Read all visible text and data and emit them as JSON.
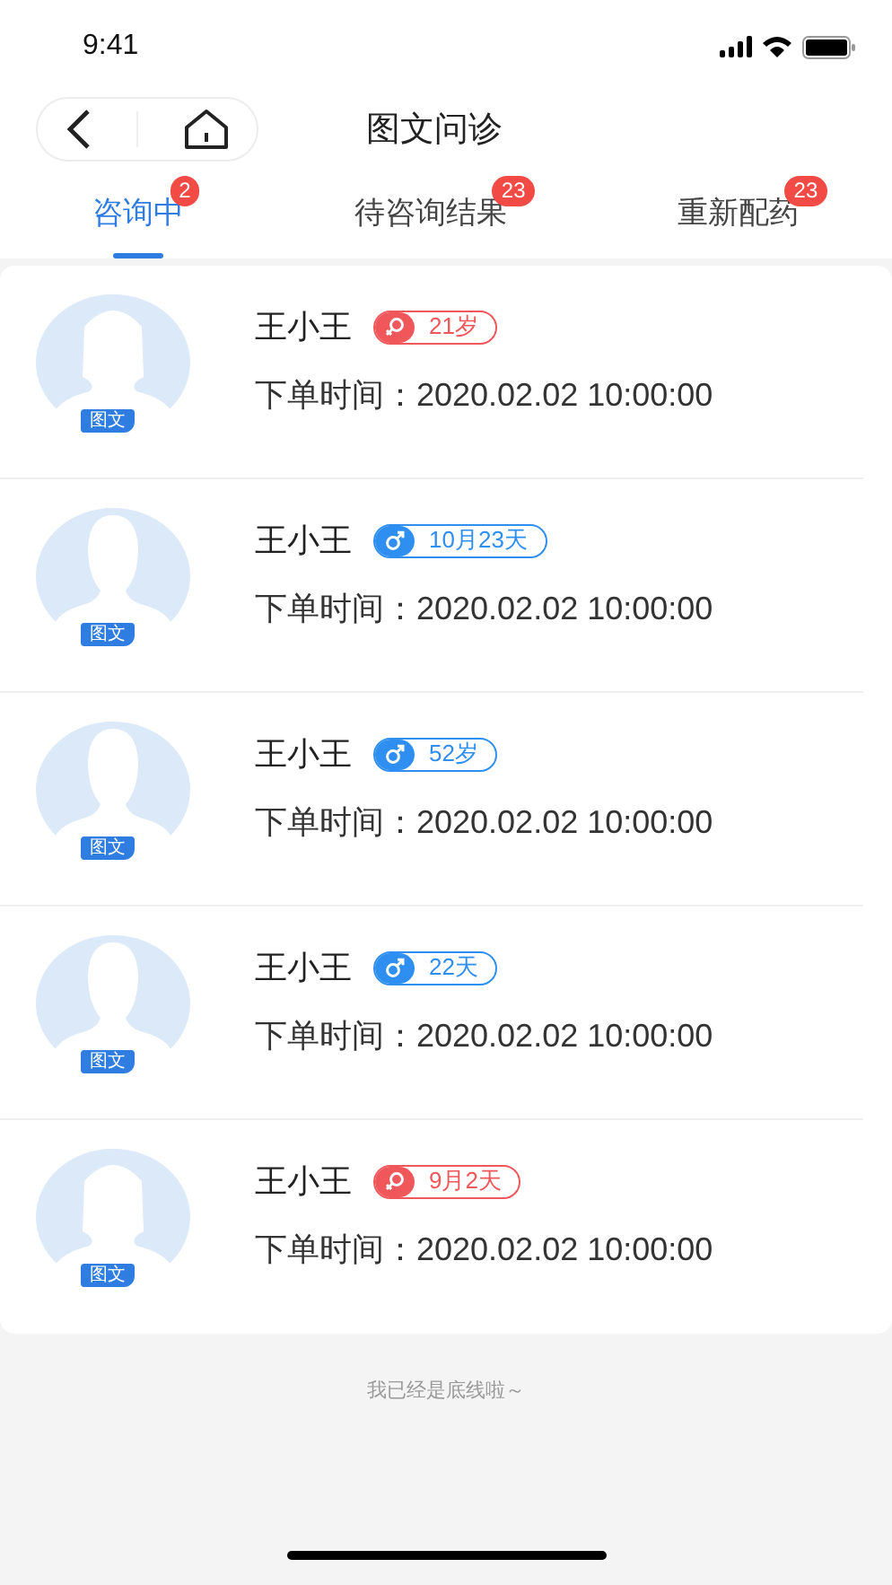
{
  "status_bar": {
    "time": "9:41"
  },
  "header": {
    "title": "图文问诊"
  },
  "tabs": [
    {
      "label": "咨询中",
      "badge": "2",
      "selected": true
    },
    {
      "label": "待咨询结果",
      "badge": "23",
      "selected": false
    },
    {
      "label": "重新配药",
      "badge": "23",
      "selected": false
    }
  ],
  "patients": [
    {
      "name": "王小王",
      "kind": "female",
      "age": "21岁",
      "order_time": "下单时间：2020.02.02 10:00:00",
      "avatar_tag": "图文"
    },
    {
      "name": "王小王",
      "kind": "male",
      "age": "10月23天",
      "order_time": "下单时间：2020.02.02 10:00:00",
      "avatar_tag": "图文"
    },
    {
      "name": "王小王",
      "kind": "male",
      "age": "52岁",
      "order_time": "下单时间：2020.02.02 10:00:00",
      "avatar_tag": "图文"
    },
    {
      "name": "王小王",
      "kind": "male",
      "age": "22天",
      "order_time": "下单时间：2020.02.02 10:00:00",
      "avatar_tag": "图文"
    },
    {
      "name": "王小王",
      "kind": "female",
      "age": "9月2天",
      "order_time": "下单时间：2020.02.02 10:00:00",
      "avatar_tag": "图文"
    }
  ],
  "footer_note": "我已经是底线啦～"
}
